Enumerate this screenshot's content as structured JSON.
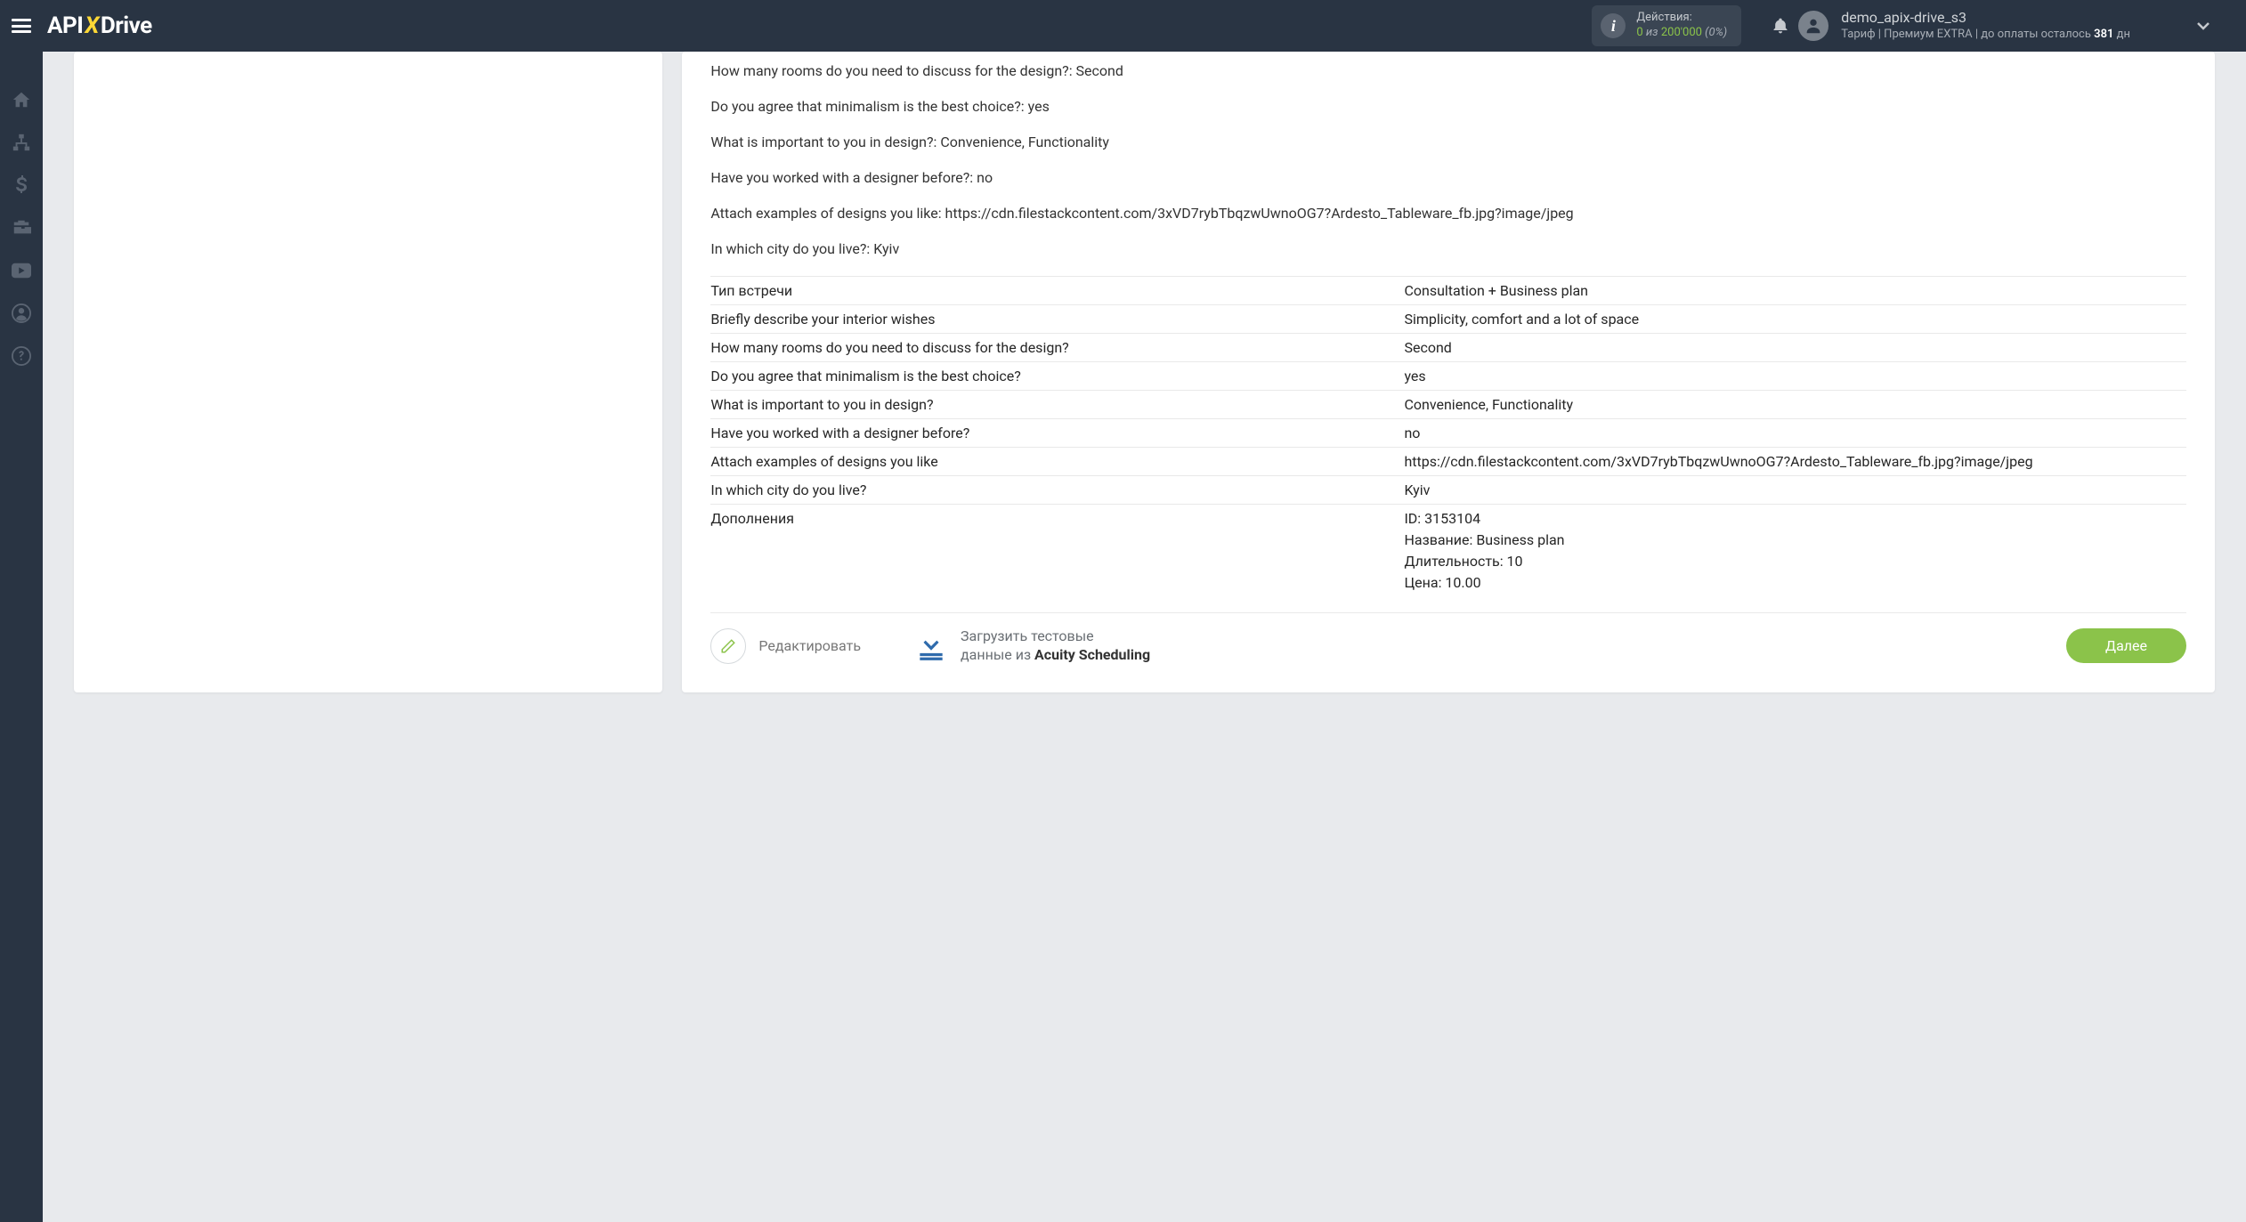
{
  "header": {
    "logo": {
      "part1": "API",
      "part2": "X",
      "part3": "Drive"
    },
    "actions": {
      "label": "Действия:",
      "count": "0",
      "of": "из",
      "total": "200'000",
      "pct": "(0%)"
    },
    "user": {
      "name": "demo_apix-drive_s3",
      "tariff_prefix": "Тариф | Премиум EXTRA | до оплаты осталось ",
      "days": "381",
      "days_suffix": " дн"
    }
  },
  "qa": [
    {
      "text": "How many rooms do you need to discuss for the design?: Second"
    },
    {
      "text": "Do you agree that minimalism is the best choice?: yes"
    },
    {
      "text": "What is important to you in design?: Convenience, Functionality"
    },
    {
      "text": "Have you worked with a designer before?: no"
    },
    {
      "text": "Attach examples of designs you like: https://cdn.filestackcontent.com/3xVD7rybTbqzwUwnoOG7?Ardesto_Tableware_fb.jpg?image/jpeg"
    },
    {
      "text": "In which city do you live?: Kyiv"
    }
  ],
  "rows": [
    {
      "label": "Тип встречи",
      "value": "Consultation + Business plan"
    },
    {
      "label": "Briefly describe your interior wishes",
      "value": "Simplicity, comfort and a lot of space"
    },
    {
      "label": "How many rooms do you need to discuss for the design?",
      "value": "Second"
    },
    {
      "label": "Do you agree that minimalism is the best choice?",
      "value": "yes"
    },
    {
      "label": "What is important to you in design?",
      "value": "Convenience, Functionality"
    },
    {
      "label": "Have you worked with a designer before?",
      "value": "no"
    },
    {
      "label": "Attach examples of designs you like",
      "value": "https://cdn.filestackcontent.com/3xVD7rybTbqzwUwnoOG7?Ardesto_Tableware_fb.jpg?image/jpeg"
    },
    {
      "label": "In which city do you live?",
      "value": "Kyiv"
    },
    {
      "label": "Дополнения",
      "value": "ID: 3153104\nНазвание: Business plan\nДлительность: 10\nЦена: 10.00"
    }
  ],
  "buttons": {
    "edit": "Редактировать",
    "load_line1": "Загрузить тестовые",
    "load_line2_prefix": "данные из ",
    "load_source": "Acuity Scheduling",
    "next": "Далее"
  }
}
